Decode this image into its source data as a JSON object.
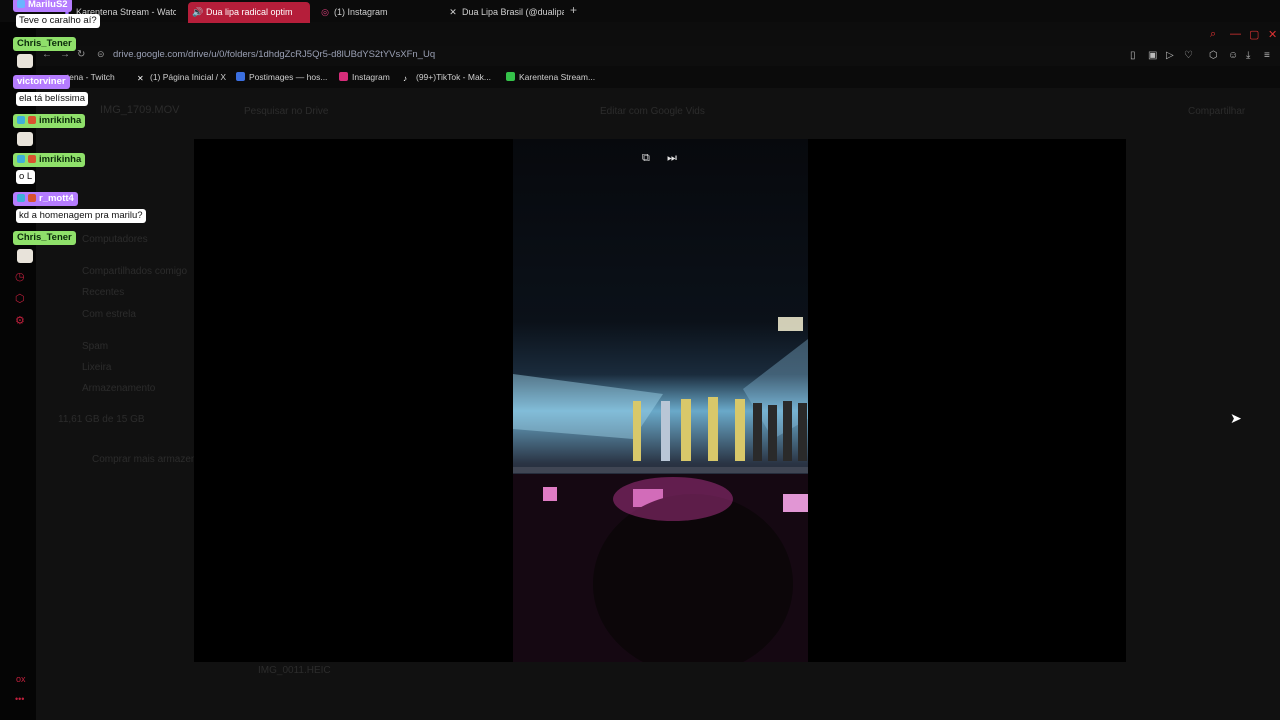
{
  "tabs": [
    {
      "label": "Karentena Stream - Watch",
      "icon": "twitch-icon",
      "active": false
    },
    {
      "label": "Dua lipa radical optim",
      "icon": "audio-playing-icon",
      "active": true
    },
    {
      "label": "(1) Instagram",
      "icon": "instagram-icon",
      "active": false
    },
    {
      "label": "Dua Lipa Brasil (@dualipa",
      "icon": "x-icon",
      "active": false
    }
  ],
  "address": {
    "url": "drive.google.com/drive/u/0/folders/1dhdgZcRJ5Qr5-d8lUBdYS2tYVsXFn_Uq"
  },
  "bookmarks": [
    {
      "label": "ntena - Twitch",
      "color": "#7a4be0"
    },
    {
      "label": "(1) Página Inicial / X",
      "color": "#ffffff"
    },
    {
      "label": "Postimages — hos...",
      "color": "#3b6fe0"
    },
    {
      "label": "Instagram",
      "color": "#d62d7a"
    },
    {
      "label": "(99+)TikTok - Mak...",
      "color": "#ffffff"
    },
    {
      "label": "Karentena Stream...",
      "color": "#35c24a"
    }
  ],
  "drive": {
    "file_title": "IMG_1709.MOV",
    "search_placeholder": "Pesquisar no Drive",
    "open_with": "Editar com Google Vids",
    "share": "Compartilhar",
    "storage": "11,61 GB de 15 GB",
    "buy_storage": "Comprar mais armazenamento",
    "sidebar": [
      "Computadores",
      "Compartilhados comigo",
      "Recentes",
      "Com estrela",
      "Spam",
      "Lixeira",
      "Armazenamento"
    ],
    "row_file": "IMG_0011.HEIC"
  },
  "chat": [
    {
      "user": "MariluS2",
      "name_color": "#b57cff",
      "message": "Teve o caralho aí?",
      "emote": false
    },
    {
      "user": "Chris_Tener",
      "name_color": "#8fe06a",
      "message": "",
      "emote": true
    },
    {
      "user": "victorviner",
      "name_color": "#b57cff",
      "message": "ela tá belíssima",
      "emote": false
    },
    {
      "user": "imrikinha",
      "name_color": "#8fe06a",
      "message": "",
      "emote": true
    },
    {
      "user": "imrikinha",
      "name_color": "#8fe06a",
      "message": "o L",
      "emote": false
    },
    {
      "user": "r_mott4",
      "name_color": "#b57cff",
      "message": "kd a homenagem pra marilu?",
      "emote": false
    },
    {
      "user": "Chris_Tener",
      "name_color": "#8fe06a",
      "message": "",
      "emote": true
    }
  ],
  "colors": {
    "accent": "#b51e3a",
    "rail_icon": "#c2203d"
  }
}
